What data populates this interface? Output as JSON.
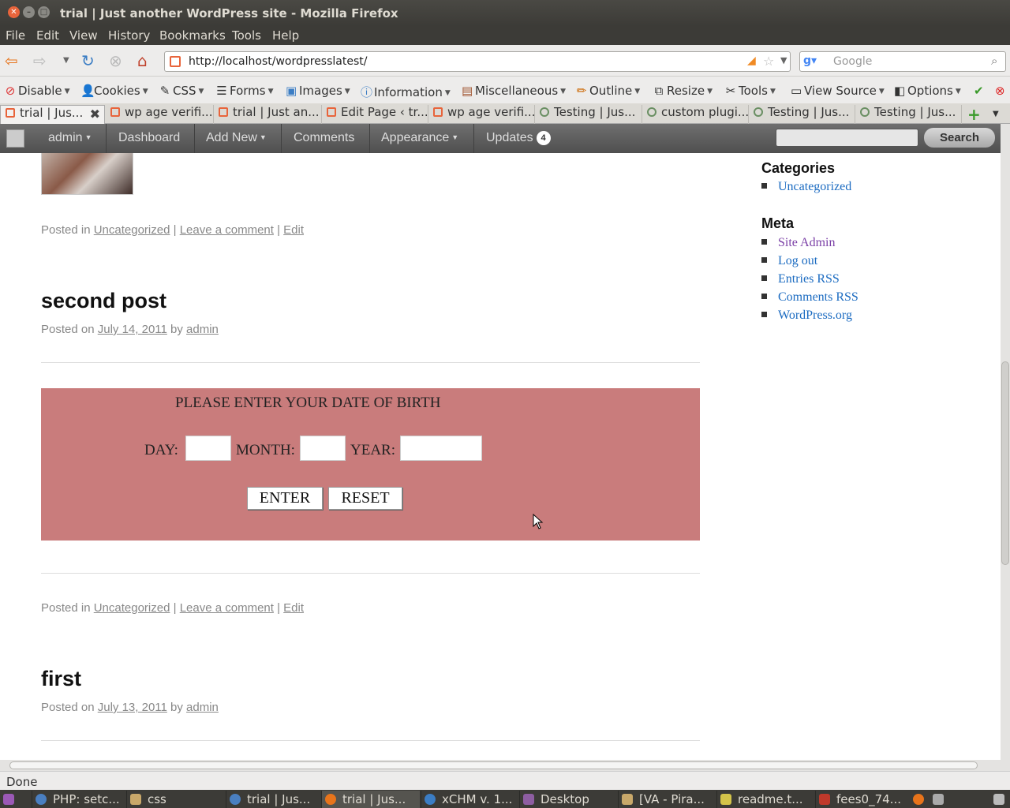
{
  "window": {
    "title": "trial | Just another WordPress site - Mozilla Firefox"
  },
  "menubar": [
    "File",
    "Edit",
    "View",
    "History",
    "Bookmarks",
    "Tools",
    "Help"
  ],
  "navigation": {
    "url": "http://localhost/wordpresslatest/",
    "search_placeholder": "Google"
  },
  "devtoolbar": [
    "Disable",
    "Cookies",
    "CSS",
    "Forms",
    "Images",
    "Information",
    "Miscellaneous",
    "Outline",
    "Resize",
    "Tools",
    "View Source",
    "Options"
  ],
  "tabs": [
    "trial | Jus...",
    "wp age verifi...",
    "trial | Just an...",
    "Edit Page ‹ tr...",
    "wp age verifi...",
    "Testing | Jus...",
    "custom plugi...",
    "Testing | Jus...",
    "Testing | Jus..."
  ],
  "adminbar": {
    "user": "admin",
    "dashboard": "Dashboard",
    "add_new": "Add New",
    "comments": "Comments",
    "appearance": "Appearance",
    "updates": "Updates",
    "updates_count": "4",
    "search_button": "Search"
  },
  "posts": [
    {
      "meta_prefix": "Posted in",
      "category": "Uncategorized",
      "leave_comment": "Leave a comment",
      "edit": "Edit"
    },
    {
      "title": "second post",
      "posted_on": "Posted on",
      "date": "July 14, 2011",
      "by": "by",
      "author": "admin",
      "meta_prefix": "Posted in",
      "category": "Uncategorized",
      "leave_comment": "Leave a comment",
      "edit": "Edit"
    },
    {
      "title": "first",
      "posted_on": "Posted on",
      "date": "July 13, 2011",
      "by": "by",
      "author": "admin"
    }
  ],
  "age_form": {
    "heading": "PLEASE ENTER YOUR DATE OF BIRTH",
    "day_label": "DAY:",
    "month_label": "MONTH:",
    "year_label": "YEAR:",
    "day_value": "",
    "month_value": "",
    "year_value": "",
    "enter_button": "ENTER",
    "reset_button": "RESET",
    "background_color": "#c97c7c"
  },
  "sidebar": {
    "categories_title": "Categories",
    "categories": [
      "Uncategorized"
    ],
    "meta_title": "Meta",
    "meta_links": [
      "Site Admin",
      "Log out",
      "Entries RSS",
      "Comments RSS",
      "WordPress.org"
    ]
  },
  "status": "Done",
  "taskbar": [
    "PHP: setc...",
    "css",
    "trial | Jus...",
    "trial | Jus...",
    "xCHM v. 1...",
    "Desktop",
    "[VA - Pira...",
    "readme.t...",
    "fees0_74..."
  ]
}
